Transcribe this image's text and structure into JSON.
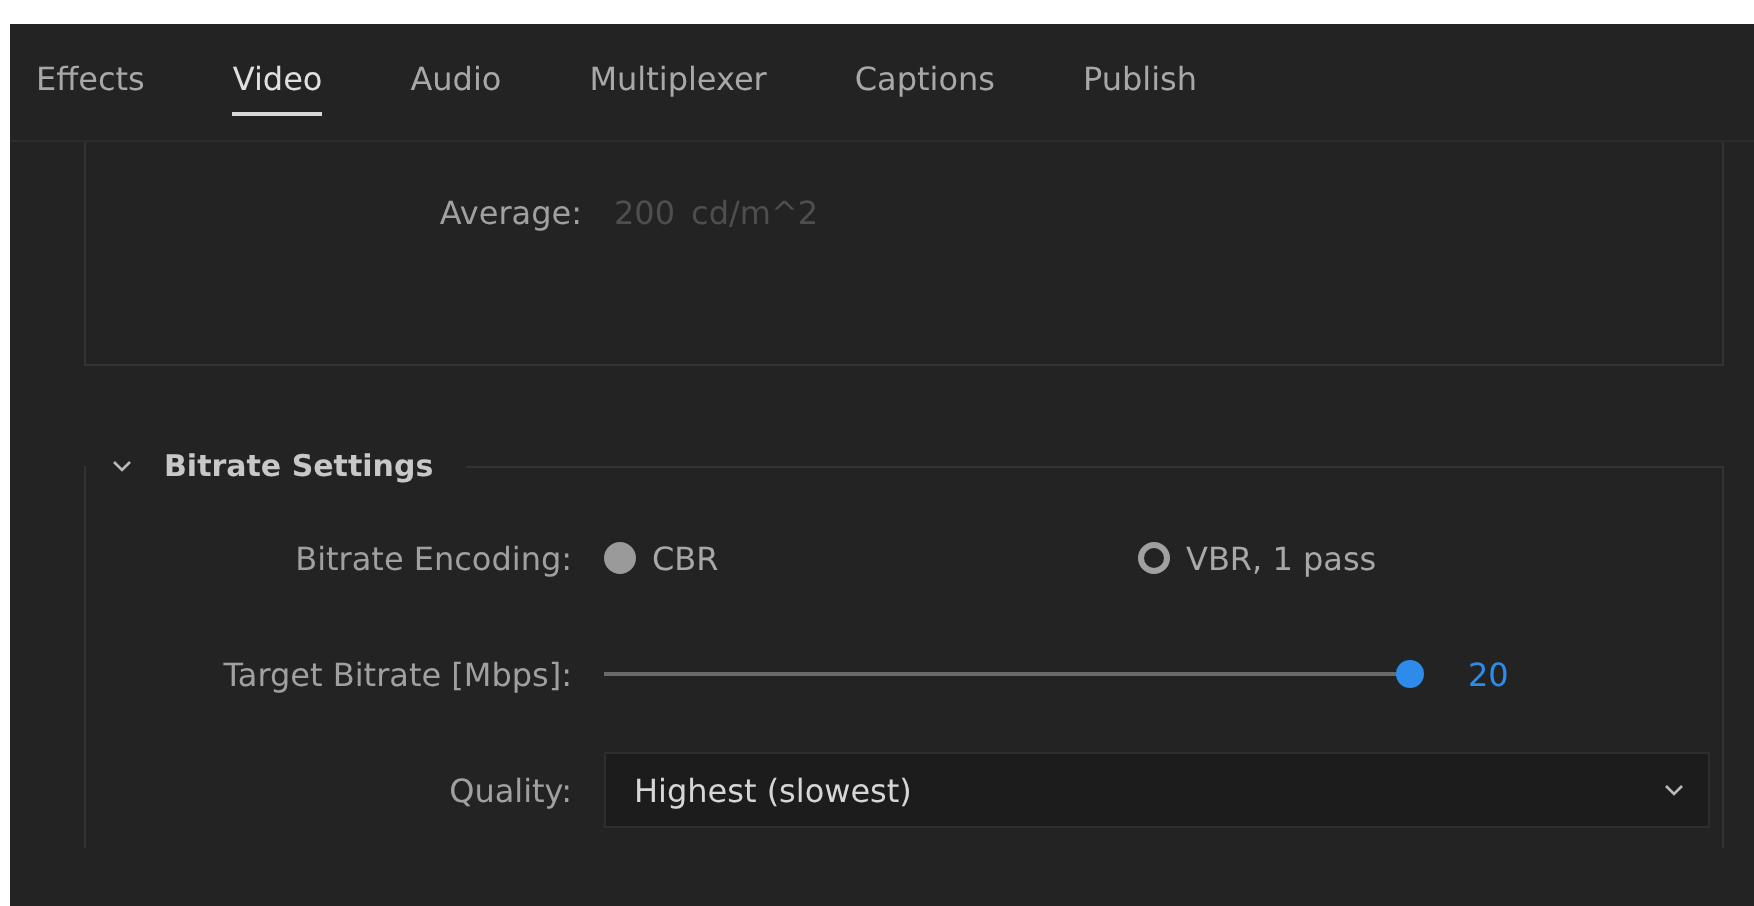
{
  "tabs": [
    {
      "label": "Effects",
      "selected": false
    },
    {
      "label": "Video",
      "selected": true
    },
    {
      "label": "Audio",
      "selected": false
    },
    {
      "label": "Multiplexer",
      "selected": false
    },
    {
      "label": "Captions",
      "selected": false
    },
    {
      "label": "Publish",
      "selected": false
    }
  ],
  "average": {
    "label": "Average:",
    "value": "200",
    "unit": "cd/m^2",
    "disabled": true
  },
  "bitrate_section": {
    "title": "Bitrate Settings",
    "expanded": true,
    "encoding": {
      "label": "Bitrate Encoding:",
      "options": [
        {
          "label": "CBR",
          "selected": true
        },
        {
          "label": "VBR, 1 pass",
          "selected": false
        }
      ]
    },
    "target": {
      "label": "Target Bitrate [Mbps]:",
      "level": 1,
      "reading": "20"
    },
    "quality": {
      "label": "Quality:",
      "value": "Highest (slowest)"
    }
  }
}
